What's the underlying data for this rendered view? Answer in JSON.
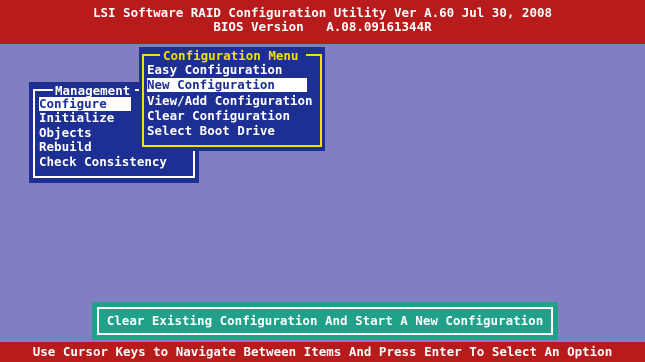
{
  "title_bar": {
    "line1": "LSI Software RAID Configuration Utility Ver A.60 Jul 30, 2008",
    "line2": "BIOS Version   A.08.09161344R"
  },
  "management_menu": {
    "title": "Management",
    "items": [
      "Configure",
      "Initialize",
      "Objects",
      "Rebuild",
      "Check Consistency"
    ],
    "selected": "Configure"
  },
  "configuration_menu": {
    "title": "Configuration Menu",
    "items": [
      "Easy Configuration",
      "New Configuration",
      "View/Add Configuration",
      "Clear Configuration",
      "Select Boot Drive"
    ],
    "selected": "New Configuration"
  },
  "hint": "Clear Existing Configuration And Start A New Configuration",
  "status_bar": "Use Cursor Keys to Navigate Between Items And Press Enter To Select An Option",
  "colors": {
    "background": "#7f7fc1",
    "title_bar": "#b81b1b",
    "menu_bg": "#1d2f92",
    "config_border": "#f2e200",
    "hint_bg": "#21a08a"
  }
}
